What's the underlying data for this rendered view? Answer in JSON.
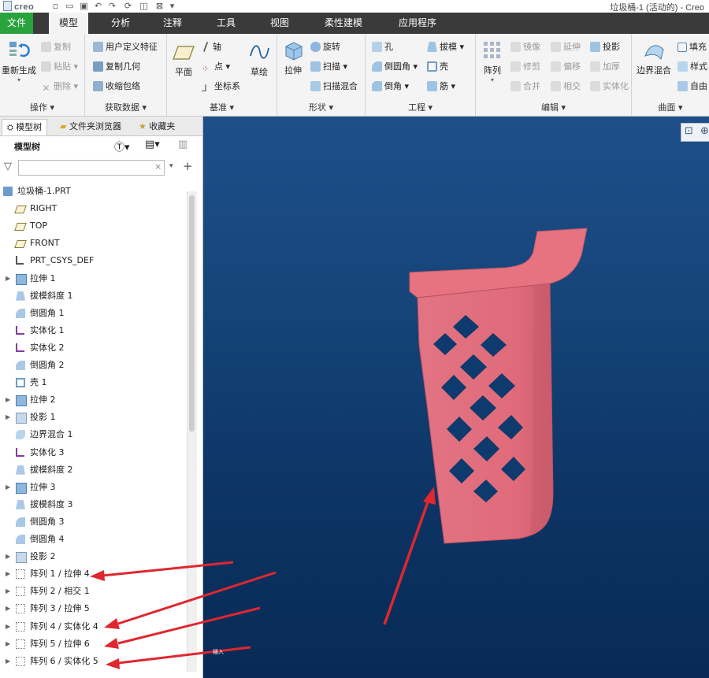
{
  "app": {
    "logo_text": "creo",
    "window_title": "垃圾桶-1 (活动的) - Creo"
  },
  "menu_tabs": [
    {
      "label": "文件"
    },
    {
      "label": "模型"
    },
    {
      "label": "分析"
    },
    {
      "label": "注释"
    },
    {
      "label": "工具"
    },
    {
      "label": "视图"
    },
    {
      "label": "柔性建模"
    },
    {
      "label": "应用程序"
    }
  ],
  "ribbon": {
    "operations": {
      "label": "操作",
      "regen": "重新生成",
      "copy": "复制",
      "paste": "粘贴",
      "delete": "删除"
    },
    "get_data": {
      "label": "获取数据",
      "udf": "用户定义特征",
      "copy_geom": "复制几何",
      "shrinkwrap": "收缩包络"
    },
    "datum": {
      "label": "基准",
      "plane": "平面",
      "axis": "轴",
      "point": "点",
      "csys": "坐标系",
      "sketch": "草绘"
    },
    "shapes": {
      "label": "形状",
      "extrude": "拉伸",
      "revolve": "旋转",
      "sweep": "扫描",
      "swept_blend": "扫描混合"
    },
    "engineering": {
      "label": "工程",
      "hole": "孔",
      "round": "倒圆角",
      "chamfer": "倒角",
      "draft": "拔模",
      "shell": "壳",
      "rib": "筋"
    },
    "editing": {
      "label": "编辑",
      "pattern": "阵列",
      "mirror": "镜像",
      "extend": "延伸",
      "project": "投影",
      "trim": "修剪",
      "offset": "偏移",
      "thicken": "加厚",
      "merge": "合并",
      "intersect": "相交",
      "solidify": "实体化"
    },
    "surfaces": {
      "label": "曲面",
      "boundary_blend": "边界混合",
      "fill": "填充",
      "style": "样式",
      "freestyle": "自由"
    }
  },
  "sidebar": {
    "tabs": [
      {
        "label": "模型树"
      },
      {
        "label": "文件夹浏览器"
      },
      {
        "label": "收藏夹"
      }
    ],
    "tree_title": "模型树",
    "search": {
      "value": "",
      "clear": "×"
    },
    "tree": [
      {
        "label": "垃圾桶-1.PRT",
        "icon": "part-icon",
        "expandable": false
      },
      {
        "label": "RIGHT",
        "icon": "datum-plane-icon",
        "expandable": false
      },
      {
        "label": "TOP",
        "icon": "datum-plane-icon",
        "expandable": false
      },
      {
        "label": "FRONT",
        "icon": "datum-plane-icon",
        "expandable": false
      },
      {
        "label": "PRT_CSYS_DEF",
        "icon": "csys-icon",
        "expandable": false
      },
      {
        "label": "拉伸 1",
        "icon": "extrude-icon",
        "expandable": true
      },
      {
        "label": "拔模斜度 1",
        "icon": "draft-icon",
        "expandable": false
      },
      {
        "label": "倒圆角 1",
        "icon": "round-icon",
        "expandable": false
      },
      {
        "label": "实体化 1",
        "icon": "solidify-icon",
        "expandable": false
      },
      {
        "label": "实体化 2",
        "icon": "solidify-icon",
        "expandable": false
      },
      {
        "label": "倒圆角 2",
        "icon": "round-icon",
        "expandable": false
      },
      {
        "label": "壳 1",
        "icon": "shell-icon",
        "expandable": false
      },
      {
        "label": "拉伸 2",
        "icon": "extrude-icon",
        "expandable": true
      },
      {
        "label": "投影 1",
        "icon": "project-icon",
        "expandable": true
      },
      {
        "label": "边界混合 1",
        "icon": "boundary-icon",
        "expandable": false
      },
      {
        "label": "实体化 3",
        "icon": "solidify-icon",
        "expandable": false
      },
      {
        "label": "拔模斜度 2",
        "icon": "draft-icon",
        "expandable": false
      },
      {
        "label": "拉伸 3",
        "icon": "extrude-icon",
        "expandable": true
      },
      {
        "label": "拔模斜度 3",
        "icon": "draft-icon",
        "expandable": false
      },
      {
        "label": "倒圆角 3",
        "icon": "round-icon",
        "expandable": false
      },
      {
        "label": "倒圆角 4",
        "icon": "round-icon",
        "expandable": false
      },
      {
        "label": "投影 2",
        "icon": "project-icon",
        "expandable": true
      },
      {
        "label": "阵列 1 / 拉伸 4",
        "icon": "pattern-icon",
        "expandable": true
      },
      {
        "label": "阵列 2 / 相交 1",
        "icon": "pattern-icon",
        "expandable": true
      },
      {
        "label": "阵列 3 / 拉伸 5",
        "icon": "pattern-icon",
        "expandable": true
      },
      {
        "label": "阵列 4 / 实体化 4",
        "icon": "pattern-icon",
        "expandable": true
      },
      {
        "label": "阵列 5 / 拉伸 6",
        "icon": "pattern-icon",
        "expandable": true
      },
      {
        "label": "阵列 6 / 实体化 5",
        "icon": "pattern-icon",
        "expandable": true
      }
    ],
    "insert_marker": "插入"
  },
  "colors": {
    "model": "#e4707e",
    "model_shade": "#c75a68",
    "annotation_arrow": "#e0272f",
    "file_tab": "#29a33c"
  }
}
